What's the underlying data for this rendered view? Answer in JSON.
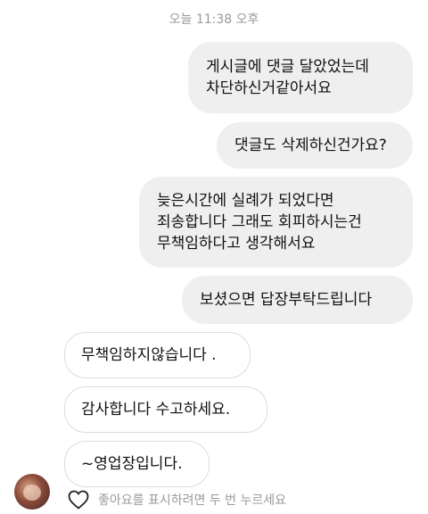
{
  "timestamp": "오늘 11:38 오후",
  "messages": [
    {
      "side": "sent",
      "text": "게시글에 댓글 달았었는데\n차단하신거같아서요"
    },
    {
      "side": "sent",
      "text": "댓글도 삭제하신건가요?"
    },
    {
      "side": "sent",
      "text": "늦은시간에 실례가 되었다면\n죄송합니다 그래도 회피하시는건\n무책임하다고 생각해서요"
    },
    {
      "side": "sent",
      "text": "보셨으면 답장부탁드립니다"
    },
    {
      "side": "received",
      "text": "무책임하지않습니다 ."
    },
    {
      "side": "received",
      "text": "감사합니다 수고하세요."
    },
    {
      "side": "received",
      "text": "~영업장입니다."
    }
  ],
  "like_hint": "좋아요를 표시하려면 두 번 누르세요",
  "icons": {
    "like": "heart-outline-icon"
  }
}
